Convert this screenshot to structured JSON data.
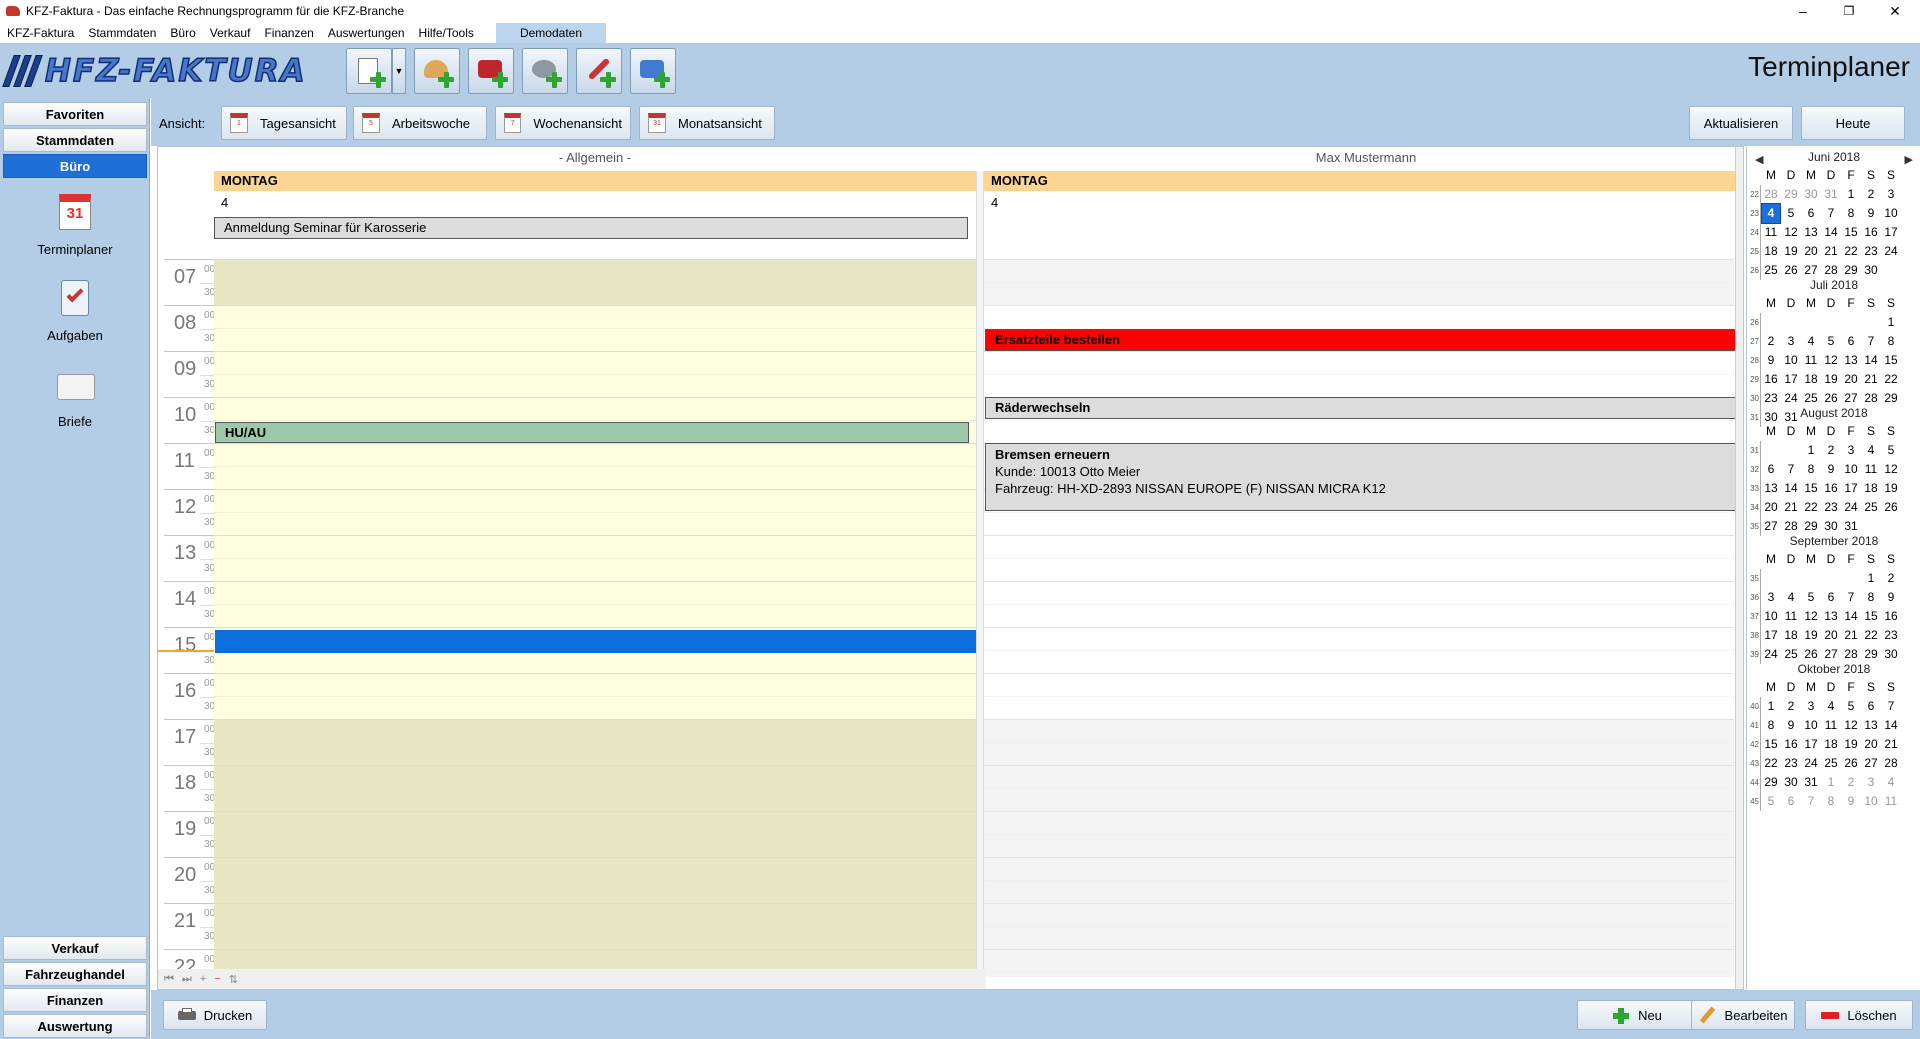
{
  "window": {
    "title": "KFZ-Faktura - Das einfache Rechnungsprogramm für die KFZ-Branche"
  },
  "menu": {
    "items": [
      "KFZ-Faktura",
      "Stammdaten",
      "Büro",
      "Verkauf",
      "Finanzen",
      "Auswertungen",
      "Hilfe/Tools"
    ],
    "demo": "Demodaten"
  },
  "toolbar": {
    "logo": "HFZ-FAKTURA",
    "page_title": "Terminplaner"
  },
  "sidebar": {
    "top": [
      "Favoriten",
      "Stammdaten",
      "Büro"
    ],
    "items": [
      "Terminplaner",
      "Aufgaben",
      "Briefe"
    ],
    "bottom": [
      "Verkauf",
      "Fahrzeughandel",
      "Finanzen",
      "Auswertung"
    ]
  },
  "viewbar": {
    "label": "Ansicht:",
    "views": [
      "Tagesansicht",
      "Arbeitswoche",
      "Wochenansicht",
      "Monatsansicht"
    ],
    "refresh": "Aktualisieren",
    "today": "Heute"
  },
  "scheduler": {
    "hours": [
      "07",
      "08",
      "09",
      "10",
      "11",
      "12",
      "13",
      "14",
      "15",
      "16",
      "17",
      "18",
      "19",
      "20",
      "21",
      "22"
    ],
    "minute_marks": [
      "00",
      "30"
    ],
    "resources": [
      {
        "name": "- Allgemein -",
        "day": "MONTAG",
        "date": "4",
        "allday": "Anmeldung Seminar für Karosserie"
      },
      {
        "name": "Max Mustermann",
        "day": "MONTAG",
        "date": "4",
        "allday": ""
      }
    ],
    "appointments": [
      {
        "title": "HU/AU",
        "color": "#9bc9a9"
      },
      {
        "title": "",
        "color": "#0a6fdc"
      },
      {
        "title": "Ersatzteile bestellen",
        "color": "#ff0000"
      },
      {
        "title": "Räderwechseln",
        "color": "#dcdcdc"
      },
      {
        "title": "Bremsen erneuern",
        "line1": "Kunde: 10013 Otto Meier",
        "line2": "Fahrzeug: HH-XD-2893 NISSAN EUROPE (F) NISSAN MICRA K12",
        "color": "#dcdcdc"
      }
    ]
  },
  "calendar": {
    "weekdays": [
      "M",
      "D",
      "M",
      "D",
      "F",
      "S",
      "S"
    ],
    "months": [
      {
        "name": "Juni 2018",
        "rows": [
          {
            "wk": "22",
            "days": [
              "28",
              "29",
              "30",
              "31",
              "1",
              "2",
              "3"
            ],
            "other": [
              0,
              1,
              2,
              3
            ]
          },
          {
            "wk": "23",
            "days": [
              "4",
              "5",
              "6",
              "7",
              "8",
              "9",
              "10"
            ],
            "sel": 0
          },
          {
            "wk": "24",
            "days": [
              "11",
              "12",
              "13",
              "14",
              "15",
              "16",
              "17"
            ]
          },
          {
            "wk": "25",
            "days": [
              "18",
              "19",
              "20",
              "21",
              "22",
              "23",
              "24"
            ]
          },
          {
            "wk": "26",
            "days": [
              "25",
              "26",
              "27",
              "28",
              "29",
              "30",
              ""
            ]
          }
        ]
      },
      {
        "name": "Juli 2018",
        "rows": [
          {
            "wk": "26",
            "days": [
              "",
              "",
              "",
              "",
              "",
              "",
              "1"
            ]
          },
          {
            "wk": "27",
            "days": [
              "2",
              "3",
              "4",
              "5",
              "6",
              "7",
              "8"
            ]
          },
          {
            "wk": "28",
            "days": [
              "9",
              "10",
              "11",
              "12",
              "13",
              "14",
              "15"
            ]
          },
          {
            "wk": "29",
            "days": [
              "16",
              "17",
              "18",
              "19",
              "20",
              "21",
              "22"
            ]
          },
          {
            "wk": "30",
            "days": [
              "23",
              "24",
              "25",
              "26",
              "27",
              "28",
              "29"
            ]
          },
          {
            "wk": "31",
            "days": [
              "30",
              "31",
              "",
              "",
              "",
              "",
              ""
            ]
          }
        ]
      },
      {
        "name": "August 2018",
        "rows": [
          {
            "wk": "31",
            "days": [
              "",
              "",
              "1",
              "2",
              "3",
              "4",
              "5"
            ]
          },
          {
            "wk": "32",
            "days": [
              "6",
              "7",
              "8",
              "9",
              "10",
              "11",
              "12"
            ]
          },
          {
            "wk": "33",
            "days": [
              "13",
              "14",
              "15",
              "16",
              "17",
              "18",
              "19"
            ]
          },
          {
            "wk": "34",
            "days": [
              "20",
              "21",
              "22",
              "23",
              "24",
              "25",
              "26"
            ]
          },
          {
            "wk": "35",
            "days": [
              "27",
              "28",
              "29",
              "30",
              "31",
              "",
              ""
            ]
          }
        ]
      },
      {
        "name": "September 2018",
        "rows": [
          {
            "wk": "35",
            "days": [
              "",
              "",
              "",
              "",
              "",
              "1",
              "2"
            ]
          },
          {
            "wk": "36",
            "days": [
              "3",
              "4",
              "5",
              "6",
              "7",
              "8",
              "9"
            ]
          },
          {
            "wk": "37",
            "days": [
              "10",
              "11",
              "12",
              "13",
              "14",
              "15",
              "16"
            ]
          },
          {
            "wk": "38",
            "days": [
              "17",
              "18",
              "19",
              "20",
              "21",
              "22",
              "23"
            ]
          },
          {
            "wk": "39",
            "days": [
              "24",
              "25",
              "26",
              "27",
              "28",
              "29",
              "30"
            ]
          }
        ]
      },
      {
        "name": "Oktober 2018",
        "rows": [
          {
            "wk": "40",
            "days": [
              "1",
              "2",
              "3",
              "4",
              "5",
              "6",
              "7"
            ]
          },
          {
            "wk": "41",
            "days": [
              "8",
              "9",
              "10",
              "11",
              "12",
              "13",
              "14"
            ]
          },
          {
            "wk": "42",
            "days": [
              "15",
              "16",
              "17",
              "18",
              "19",
              "20",
              "21"
            ]
          },
          {
            "wk": "43",
            "days": [
              "22",
              "23",
              "24",
              "25",
              "26",
              "27",
              "28"
            ]
          },
          {
            "wk": "44",
            "days": [
              "29",
              "30",
              "31",
              "1",
              "2",
              "3",
              "4"
            ],
            "other": [
              3,
              4,
              5,
              6
            ]
          },
          {
            "wk": "45",
            "days": [
              "5",
              "6",
              "7",
              "8",
              "9",
              "10",
              "11"
            ],
            "other": [
              0,
              1,
              2,
              3,
              4,
              5,
              6
            ]
          }
        ]
      }
    ]
  },
  "bottombar": {
    "print": "Drucken",
    "new": "Neu",
    "edit": "Bearbeiten",
    "delete": "Löschen"
  },
  "colors": {
    "panel": "#b3cde7",
    "active": "#1f6fd8",
    "dayhead": "#fcd593",
    "worktime": "#fdfde0",
    "offtime": "#e6e6c4"
  }
}
